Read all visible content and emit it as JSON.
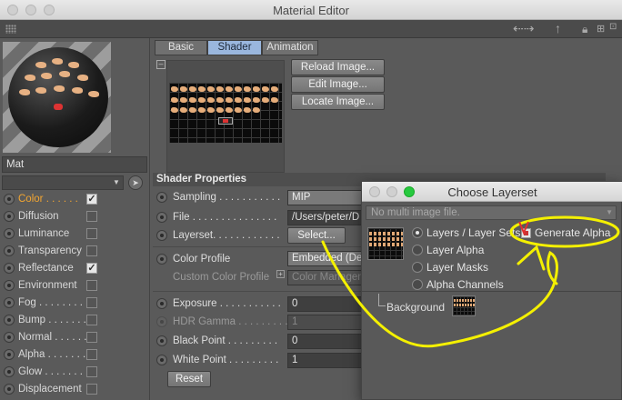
{
  "window": {
    "title": "Material Editor"
  },
  "material": {
    "name": "Mat"
  },
  "channels": [
    {
      "label": "Color",
      "dots": ". . . . . .",
      "checked": true,
      "active": true
    },
    {
      "label": "Diffusion",
      "dots": "",
      "checked": false,
      "active": false
    },
    {
      "label": "Luminance",
      "dots": "",
      "checked": false,
      "active": false
    },
    {
      "label": "Transparency",
      "dots": "",
      "checked": false,
      "active": false
    },
    {
      "label": "Reflectance",
      "dots": "",
      "checked": true,
      "active": false
    },
    {
      "label": "Environment",
      "dots": "",
      "checked": false,
      "active": false
    },
    {
      "label": "Fog",
      "dots": ". . . . . . . . .",
      "checked": false,
      "active": false
    },
    {
      "label": "Bump",
      "dots": ". . . . . . .",
      "checked": false,
      "active": false
    },
    {
      "label": "Normal",
      "dots": ". . . . . .",
      "checked": false,
      "active": false
    },
    {
      "label": "Alpha",
      "dots": ". . . . . . .",
      "checked": false,
      "active": false
    },
    {
      "label": "Glow",
      "dots": ". . . . . . . .",
      "checked": false,
      "active": false
    },
    {
      "label": "Displacement",
      "dots": "",
      "checked": false,
      "active": false
    }
  ],
  "tabs": [
    {
      "label": "Basic",
      "active": false
    },
    {
      "label": "Shader",
      "active": true
    },
    {
      "label": "Animation",
      "active": false
    }
  ],
  "image_buttons": {
    "reload": "Reload Image...",
    "edit": "Edit Image...",
    "locate": "Locate Image..."
  },
  "shader_properties": {
    "title": "Shader Properties",
    "sampling": {
      "label": "Sampling . . . . . . . . . . .",
      "value": "MIP"
    },
    "file": {
      "label": "File . . . . . . . . . . . . . . .",
      "value": "/Users/peter/D"
    },
    "layerset": {
      "label": "Layerset. . . . . . . . . . . .",
      "button": "Select..."
    },
    "color_profile": {
      "label": "Color Profile",
      "value": "Embedded (De"
    },
    "custom_color_profile": {
      "label": "Custom Color Profile",
      "value": "Color Managen"
    },
    "exposure": {
      "label": "Exposure . . . . . . . . . . .",
      "value": "0"
    },
    "hdr_gamma": {
      "label": "HDR Gamma . . . . . . . . .",
      "value": "1"
    },
    "black_point": {
      "label": "Black Point . . . . . . . . .",
      "value": "0"
    },
    "white_point": {
      "label": "White Point . . . . . . . . .",
      "value": "1"
    },
    "reset": "Reset"
  },
  "dialog": {
    "title": "Choose Layerset",
    "file_dropdown": "No multi image file.",
    "options": [
      {
        "label": "Layers / Layer Sets",
        "selected": true
      },
      {
        "label": "Layer Alpha",
        "selected": false
      },
      {
        "label": "Layer Masks",
        "selected": false
      },
      {
        "label": "Alpha Channels",
        "selected": false
      }
    ],
    "generate_alpha": {
      "label": "Generate Alpha",
      "checked": true
    },
    "layers": [
      {
        "name": "Background"
      }
    ]
  },
  "colors": {
    "tab_active": "#9ab7de",
    "channel_active": "#f2a531",
    "annotation": "#f4f000",
    "close_traffic": "#27c93f"
  }
}
